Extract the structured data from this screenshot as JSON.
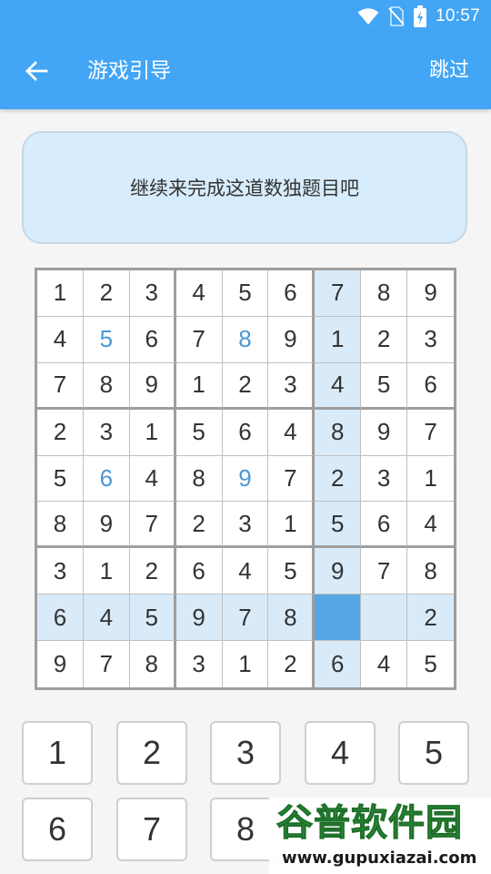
{
  "status_bar": {
    "time": "10:57",
    "icons": [
      "wifi-icon",
      "no-sim-icon",
      "battery-charging-icon"
    ]
  },
  "app_bar": {
    "title": "游戏引导",
    "skip_label": "跳过",
    "back_icon": "arrow-left-icon"
  },
  "hint": {
    "text": "继续来完成这道数独题目吧"
  },
  "board": {
    "rows": [
      [
        "1",
        "2",
        "3",
        "4",
        "5",
        "6",
        "7",
        "8",
        "9"
      ],
      [
        "4",
        "5",
        "6",
        "7",
        "8",
        "9",
        "1",
        "2",
        "3"
      ],
      [
        "7",
        "8",
        "9",
        "1",
        "2",
        "3",
        "4",
        "5",
        "6"
      ],
      [
        "2",
        "3",
        "1",
        "5",
        "6",
        "4",
        "8",
        "9",
        "7"
      ],
      [
        "5",
        "6",
        "4",
        "8",
        "9",
        "7",
        "2",
        "3",
        "1"
      ],
      [
        "8",
        "9",
        "7",
        "2",
        "3",
        "1",
        "5",
        "6",
        "4"
      ],
      [
        "3",
        "1",
        "2",
        "6",
        "4",
        "5",
        "9",
        "7",
        "8"
      ],
      [
        "6",
        "4",
        "5",
        "9",
        "7",
        "8",
        "",
        "",
        "2"
      ],
      [
        "9",
        "7",
        "8",
        "3",
        "1",
        "2",
        "6",
        "4",
        "5"
      ]
    ],
    "selected_cell": {
      "row": 7,
      "col": 6
    },
    "user_entered_cells": [
      [
        1,
        1
      ],
      [
        1,
        4
      ],
      [
        4,
        1
      ],
      [
        4,
        4
      ]
    ],
    "colors": {
      "highlight": "#d9ebf9",
      "selected": "#55a6e2",
      "user_digit": "#4a98d6"
    }
  },
  "keypad": {
    "keys": [
      "1",
      "2",
      "3",
      "4",
      "5",
      "6",
      "7",
      "8"
    ]
  },
  "watermark": {
    "title": "谷普软件园",
    "url": "www.gupuxiazai.com"
  },
  "theme": {
    "primary": "#42a5f5",
    "hint_background": "#d7ecfd"
  }
}
